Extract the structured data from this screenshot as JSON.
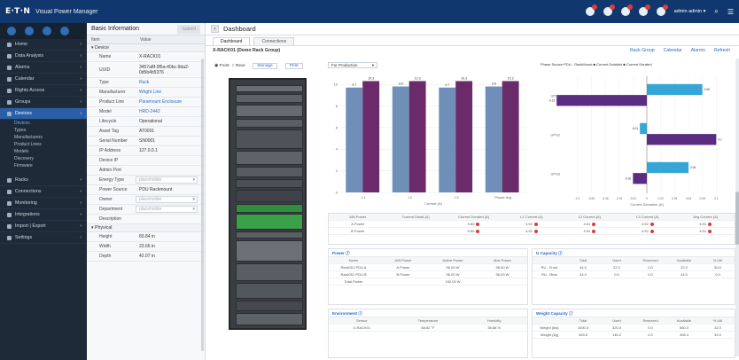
{
  "topbar": {
    "logo": "E·T·N",
    "app": "Visual Power Manager",
    "user": "admin admin ▾"
  },
  "sidebar": {
    "items": [
      {
        "label": "Home",
        "key": "home"
      },
      {
        "label": "Data Analysis",
        "key": "data-analysis"
      },
      {
        "label": "Alarms",
        "key": "alarms"
      },
      {
        "label": "Calendar",
        "key": "calendar"
      },
      {
        "label": "Rights Access",
        "key": "rights-access"
      },
      {
        "label": "Groups",
        "key": "groups"
      },
      {
        "label": "Devices",
        "key": "devices"
      }
    ],
    "sub": [
      "Devices",
      "Types",
      "Manufacturers",
      "Product Lines",
      "Models",
      "Discovery",
      "Firmware"
    ],
    "items2": [
      {
        "label": "Racks",
        "key": "racks"
      },
      {
        "label": "Connections",
        "key": "connections"
      },
      {
        "label": "Monitoring",
        "key": "monitoring"
      },
      {
        "label": "Integrations",
        "key": "integrations"
      },
      {
        "label": "Import | Export",
        "key": "import-export"
      },
      {
        "label": "Settings",
        "key": "settings"
      }
    ]
  },
  "basic": {
    "title": "Basic Information",
    "submit": "Submit",
    "col_item": "Item",
    "col_value": "Value",
    "section_device": "Device",
    "section_physical": "Physical",
    "rows": [
      {
        "k": "Name",
        "v": "X-RACK01",
        "t": "plain"
      },
      {
        "k": "UUID",
        "v": "3457a8f-9f5a-40bc-9da2-0d5b4b5376",
        "t": "plain"
      },
      {
        "k": "Type",
        "v": "Rack",
        "t": "link"
      },
      {
        "k": "Manufacturer",
        "v": "Wright Line",
        "t": "link"
      },
      {
        "k": "Product Line",
        "v": "Paramount Enclosure",
        "t": "link"
      },
      {
        "k": "Model",
        "v": "HRD-2442",
        "t": "link"
      },
      {
        "k": "Lifecycle",
        "v": "Operational",
        "t": "plain"
      },
      {
        "k": "Asset Tag",
        "v": "AT0001",
        "t": "plain"
      },
      {
        "k": "Serial Number",
        "v": "SN0001",
        "t": "plain"
      },
      {
        "k": "IP Address",
        "v": "127.0.0.1",
        "t": "plain"
      },
      {
        "k": "Device IP",
        "v": "",
        "t": "plain"
      },
      {
        "k": "Admin Port",
        "v": "",
        "t": "plain"
      },
      {
        "k": "Energy Type",
        "v": "placeholder",
        "t": "input"
      },
      {
        "k": "Power Source",
        "v": "PDU Rackmount",
        "t": "plain"
      },
      {
        "k": "Owner",
        "v": "placeholder",
        "t": "input"
      },
      {
        "k": "Department",
        "v": "placeholder",
        "t": "input"
      },
      {
        "k": "Description",
        "v": "",
        "t": "plain"
      }
    ],
    "physical": [
      {
        "k": "Height",
        "v": "83.84 in"
      },
      {
        "k": "Width",
        "v": "23.66 in"
      },
      {
        "k": "Depth",
        "v": "42.07 in"
      }
    ]
  },
  "main": {
    "title": "Dashboard",
    "tab_dashboard": "Dashboard",
    "tab_connections": "Connections",
    "rack_title": "X-RACK01 (Demo Rack Group)",
    "links": [
      "Rack Group",
      "Calendar",
      "Alarms",
      "Refresh"
    ],
    "front": "Front",
    "rear": "Rear",
    "manage": "Manage",
    "print": "Print",
    "select": "For Production",
    "chart2_hdr": "Phase Source   PDU - RackMount   ■ Current Detailed   ■ Current Derated"
  },
  "chart_data": [
    {
      "type": "bar",
      "categories": [
        "L1",
        "L2",
        "L3",
        "Phase Avg"
      ],
      "series": [
        {
          "values": [
            9.7,
            9.8,
            9.7,
            9.8
          ]
        },
        {
          "values": [
            10.3,
            10.3,
            10.3,
            10.3
          ]
        }
      ],
      "ylim": [
        0,
        10.5
      ],
      "yticks": [
        "0",
        "2",
        "4",
        "6",
        "8",
        "10"
      ],
      "xlabel": "Current (A)"
    },
    {
      "type": "bar",
      "orientation": "horizontal",
      "categories": [
        "UPS1",
        "UPS2",
        "UPS3"
      ],
      "series": [
        {
          "values": [
            0.08,
            -0.01,
            0.06
          ]
        },
        {
          "values": [
            -0.13,
            0.1,
            -0.02
          ]
        }
      ],
      "xlim": [
        -0.12,
        0.12
      ],
      "xticks": [
        "-0.1",
        "-0.08",
        "-0.06",
        "-0.04",
        "-0.02",
        "0",
        "0.02",
        "0.04",
        "0.06",
        "0.08",
        "0.1"
      ],
      "xlabel": "Current Deviation (A)"
    }
  ],
  "colors": {
    "blue": "#6f8fb8",
    "purple": "#6b2b6b",
    "cyan": "#35a6d6",
    "darkpurple": "#5a2d82"
  }
}
